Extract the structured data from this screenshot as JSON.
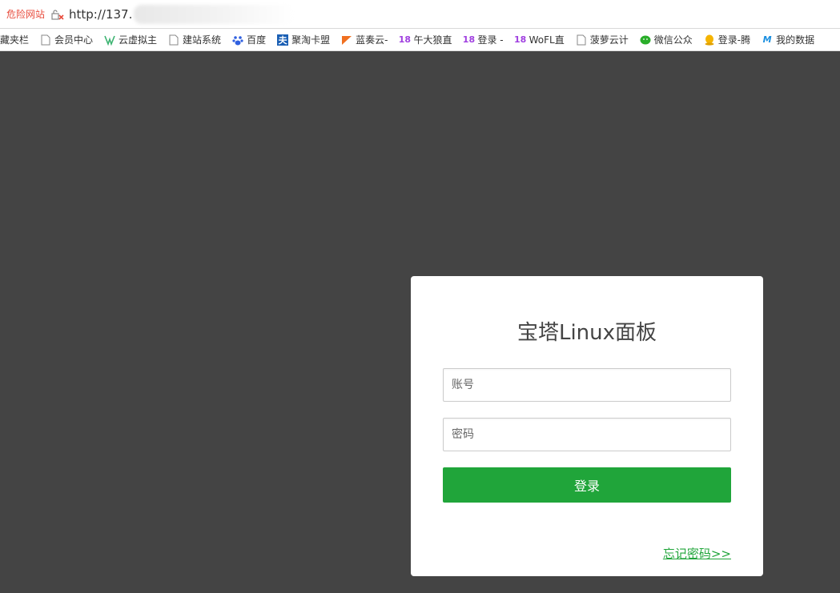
{
  "browser": {
    "danger_label": "危险网站",
    "url_visible": "http://137."
  },
  "bookmarks": [
    {
      "label": "藏夹栏",
      "icon": "none"
    },
    {
      "label": "会员中心",
      "icon": "page-icon"
    },
    {
      "label": "云虚拟主",
      "icon": "cloud-v-icon"
    },
    {
      "label": "建站系统",
      "icon": "page-icon"
    },
    {
      "label": "百度",
      "icon": "baidu-paw-icon"
    },
    {
      "label": "聚淘卡盟",
      "icon": "tianmao-icon"
    },
    {
      "label": "蓝奏云-",
      "icon": "lanzou-icon"
    },
    {
      "label": "午大狼直",
      "icon": "channel18-icon"
    },
    {
      "label": "登录 -",
      "icon": "channel18-icon"
    },
    {
      "label": "WoFL直",
      "icon": "channel18-icon"
    },
    {
      "label": "菠萝云计",
      "icon": "page-icon"
    },
    {
      "label": "微信公众",
      "icon": "wechat-icon"
    },
    {
      "label": "登录-腾",
      "icon": "qq-icon"
    },
    {
      "label": "我的数据",
      "icon": "m-logo-icon"
    }
  ],
  "login": {
    "title": "宝塔Linux面板",
    "username_placeholder": "账号",
    "password_placeholder": "密码",
    "submit_label": "登录",
    "forgot_label": "忘记密码>>"
  },
  "colors": {
    "accent": "#20a53a",
    "background": "#444444",
    "danger": "#e84c3d"
  }
}
